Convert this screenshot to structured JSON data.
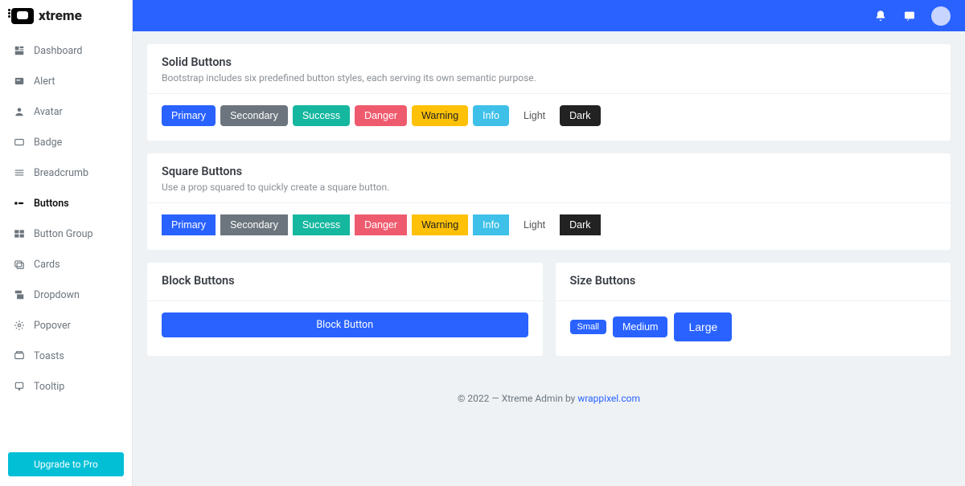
{
  "brand": "xtreme",
  "sidebar": {
    "items": [
      {
        "label": "Dashboard",
        "icon": "dashboard"
      },
      {
        "label": "Alert",
        "icon": "alert"
      },
      {
        "label": "Avatar",
        "icon": "avatar"
      },
      {
        "label": "Badge",
        "icon": "badge"
      },
      {
        "label": "Breadcrumb",
        "icon": "breadcrumb"
      },
      {
        "label": "Buttons",
        "icon": "buttons"
      },
      {
        "label": "Button Group",
        "icon": "button-group"
      },
      {
        "label": "Cards",
        "icon": "cards"
      },
      {
        "label": "Dropdown",
        "icon": "dropdown"
      },
      {
        "label": "Popover",
        "icon": "popover"
      },
      {
        "label": "Toasts",
        "icon": "toasts"
      },
      {
        "label": "Tooltip",
        "icon": "tooltip"
      }
    ],
    "upgrade": "Upgrade to Pro"
  },
  "cards": {
    "solid": {
      "title": "Solid Buttons",
      "desc": "Bootstrap includes six predefined button styles, each serving its own semantic purpose.",
      "buttons": [
        "Primary",
        "Secondary",
        "Success",
        "Danger",
        "Warning",
        "Info",
        "Light",
        "Dark"
      ]
    },
    "square": {
      "title": "Square Buttons",
      "desc": "Use a prop squared to quickly create a square button.",
      "buttons": [
        "Primary",
        "Secondary",
        "Success",
        "Danger",
        "Warning",
        "Info",
        "Light",
        "Dark"
      ]
    },
    "block": {
      "title": "Block Buttons",
      "button": "Block Button"
    },
    "size": {
      "title": "Size Buttons",
      "buttons": [
        "Small",
        "Medium",
        "Large"
      ]
    }
  },
  "footer": {
    "text": "© 2022 — Xtreme Admin by ",
    "link": "wrappixel.com"
  }
}
